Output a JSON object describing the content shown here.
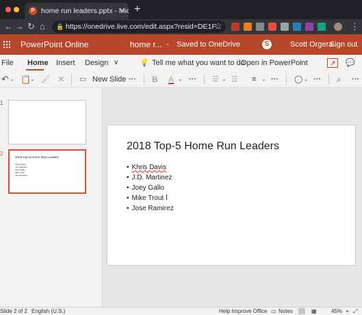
{
  "browser": {
    "tab_title": "home run leaders.pptx - Micro",
    "tab_favicon": "P",
    "tab_close_icon": "×",
    "new_tab_icon": "+",
    "url": "https://onedrive.live.com/edit.aspx?resid=DE1F...",
    "colors": {
      "close_dot": "#ff5f57",
      "min_dot": "#febc2e",
      "max_dot": "#28c840"
    }
  },
  "office": {
    "app_name": "PowerPoint Online",
    "doc_name": "home r...",
    "separator": "-",
    "save_status": "Saved to OneDrive",
    "skype_icon": "S",
    "user_name": "Scott Orgera",
    "sign_out": "Sign out",
    "brand_color": "#b7472a"
  },
  "ribbon": {
    "tabs": [
      "File",
      "Home",
      "Insert",
      "Design"
    ],
    "more": "∨",
    "tell_me": "Tell me what you want to do",
    "open_in": "Open in PowerPoint",
    "new_slide": "New Slide",
    "bold": "B",
    "font_color": "A",
    "ellipsis": "···"
  },
  "thumbnails": [
    {
      "number": "1",
      "title": "",
      "bullets": []
    },
    {
      "number": "2",
      "title": "2018 Top-5 Home Run Leaders",
      "bullets": [
        "Khris Davis",
        "J.D. Martinez",
        "Joey Gallo",
        "Mike Trout",
        "Jose Ramirez"
      ]
    }
  ],
  "slide": {
    "title": "2018 Top-5 Home Run Leaders",
    "bullets": [
      "Khris Davis",
      "J.D. Martinez",
      "Joey Gallo",
      "Mike Trout",
      "Jose Ramirez"
    ]
  },
  "status": {
    "slide_count": "Slide 2 of 2",
    "language": "English (U.S.)",
    "help": "Help Improve Office",
    "notes": "Notes",
    "zoom": "45%"
  }
}
